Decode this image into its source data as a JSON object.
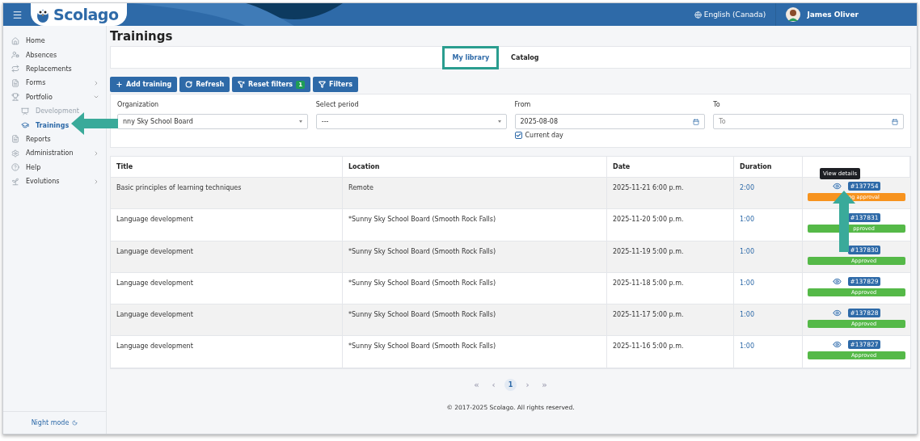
{
  "header": {
    "brand": "Scolago",
    "language": "English (Canada)",
    "user": "James Oliver"
  },
  "sidebar": {
    "items": [
      {
        "label": "Home",
        "selected": false
      },
      {
        "label": "Absences",
        "selected": false
      },
      {
        "label": "Replacements",
        "selected": false
      },
      {
        "label": "Forms",
        "selected": false,
        "expanded": false
      },
      {
        "label": "Portfolio",
        "selected": false,
        "expanded": true,
        "children": [
          {
            "label": "Development",
            "selected": false,
            "disabled": true
          },
          {
            "label": "Trainings",
            "selected": true,
            "disabled": false
          }
        ]
      },
      {
        "label": "Reports",
        "selected": false
      },
      {
        "label": "Administration",
        "selected": false,
        "expanded": false
      },
      {
        "label": "Help",
        "selected": false
      },
      {
        "label": "Evolutions",
        "selected": false,
        "expanded": false
      }
    ],
    "night_mode": "Night mode"
  },
  "page_title": "Trainings",
  "tabs": [
    {
      "label": "My library",
      "selected": true
    },
    {
      "label": "Catalog",
      "selected": false
    }
  ],
  "toolbar": [
    {
      "label": "Add training"
    },
    {
      "label": "Refresh"
    },
    {
      "label": "Reset filters",
      "badge": "1"
    },
    {
      "label": "Filters"
    }
  ],
  "filters": [
    {
      "label": "Organization",
      "kind": "select",
      "value": "nny Sky School Board"
    },
    {
      "label": "Select period",
      "kind": "select",
      "value": "---"
    },
    {
      "label": "From",
      "kind": "date",
      "value": "2025-08-08",
      "checkbox": {
        "label": "Current day",
        "checked": true
      }
    },
    {
      "label": "To",
      "kind": "date",
      "placeholder": "To"
    }
  ],
  "table": {
    "columns": [
      "Title",
      "Location",
      "Date",
      "Duration"
    ],
    "rows": [
      {
        "title": "Basic principles of learning techniques",
        "location": "Remote",
        "date": "2025-11-21 6:00 p.m.",
        "duration": "2:00",
        "id": "#137754",
        "status": "ng approval",
        "color": "#f7931e"
      },
      {
        "title": "Language development",
        "location": "*Sunny Sky School Board (Smooth Rock Falls)",
        "date": "2025-11-20 5:00 p.m.",
        "duration": "1:00",
        "id": "#137831",
        "status": "pproved",
        "color": "#55b948"
      },
      {
        "title": "Language development",
        "location": "*Sunny Sky School Board (Smooth Rock Falls)",
        "date": "2025-11-19 5:00 p.m.",
        "duration": "1:00",
        "id": "#137830",
        "status": "Approved",
        "color": "#55b948"
      },
      {
        "title": "Language development",
        "location": "*Sunny Sky School Board (Smooth Rock Falls)",
        "date": "2025-11-18 5:00 p.m.",
        "duration": "1:00",
        "id": "#137829",
        "status": "Approved",
        "color": "#55b948"
      },
      {
        "title": "Language development",
        "location": "*Sunny Sky School Board (Smooth Rock Falls)",
        "date": "2025-11-17 5:00 p.m.",
        "duration": "1:00",
        "id": "#137828",
        "status": "Approved",
        "color": "#55b948"
      },
      {
        "title": "Language development",
        "location": "*Sunny Sky School Board (Smooth Rock Falls)",
        "date": "2025-11-16 5:00 p.m.",
        "duration": "1:00",
        "id": "#137827",
        "status": "Approved",
        "color": "#55b948"
      }
    ]
  },
  "tooltip": "View details",
  "pagination": [
    {
      "label": "«"
    },
    {
      "label": "‹"
    },
    {
      "label": "1",
      "selected": true
    },
    {
      "label": "›"
    },
    {
      "label": "»"
    }
  ],
  "footer": "© 2017-2025 Scolago. All rights reserved."
}
